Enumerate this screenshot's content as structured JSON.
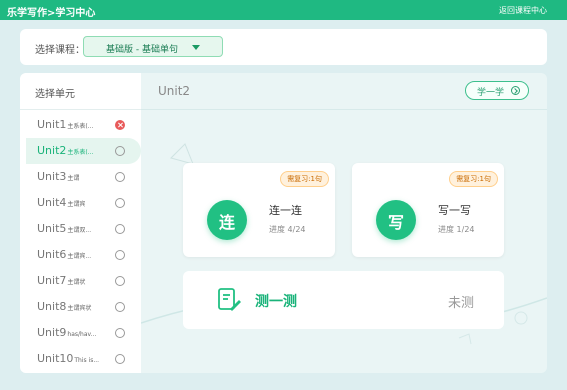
{
  "header": {
    "title": "乐学写作>学习中心",
    "back_label": "返回课程中心"
  },
  "course": {
    "label": "选择课程：",
    "selected": "基础版 - 基础单句"
  },
  "sidebar": {
    "header": "选择单元",
    "units": [
      {
        "name": "Unit1",
        "sub": "主系表(...",
        "status": "error"
      },
      {
        "name": "Unit2",
        "sub": "主系表(...",
        "status": "empty"
      },
      {
        "name": "Unit3",
        "sub": "主谓",
        "status": "empty"
      },
      {
        "name": "Unit4",
        "sub": "主谓宾",
        "status": "empty"
      },
      {
        "name": "Unit5",
        "sub": "主谓双...",
        "status": "empty"
      },
      {
        "name": "Unit6",
        "sub": "主谓宾...",
        "status": "empty"
      },
      {
        "name": "Unit7",
        "sub": "主谓状",
        "status": "empty"
      },
      {
        "name": "Unit8",
        "sub": "主谓宾状",
        "status": "empty"
      },
      {
        "name": "Unit9",
        "sub": "has/hav...",
        "status": "empty"
      },
      {
        "name": "Unit10",
        "sub": "This is...",
        "status": "empty"
      }
    ]
  },
  "content": {
    "unit_title": "Unit2",
    "learn_button": "学一学",
    "modes": [
      {
        "icon_char": "连",
        "name": "连一连",
        "progress": "进度 4/24",
        "badge": "需复习:1句"
      },
      {
        "icon_char": "写",
        "name": "写一写",
        "progress": "进度 1/24",
        "badge": "需复习:1句"
      }
    ],
    "test": {
      "name": "测一测",
      "status": "未测"
    }
  },
  "colors": {
    "brand_green": "#1fb982",
    "error_red": "#e85b5b",
    "badge_orange": "#c96a00"
  }
}
